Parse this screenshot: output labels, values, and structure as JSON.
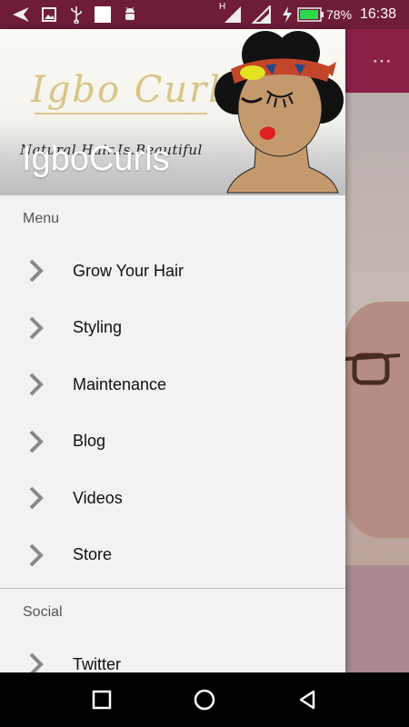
{
  "status_bar": {
    "battery_percent": "78%",
    "time": "16:38",
    "network_label": "H",
    "icons": [
      "back-arrow-icon",
      "image-icon",
      "usb-icon",
      "white-square-icon",
      "android-debug-icon",
      "signal-icon",
      "charging-icon",
      "battery-icon"
    ]
  },
  "drawer": {
    "header": {
      "title": "IgboCurls",
      "logo_text": "Igbo Curls",
      "tagline": "Natural.Hair.Is.Beautiful"
    },
    "sections": [
      {
        "label": "Menu",
        "items": [
          {
            "label": "Grow Your Hair"
          },
          {
            "label": "Styling"
          },
          {
            "label": "Maintenance"
          },
          {
            "label": "Blog"
          },
          {
            "label": "Videos"
          },
          {
            "label": "Store"
          }
        ]
      },
      {
        "label": "Social",
        "items": [
          {
            "label": "Twitter"
          }
        ]
      }
    ]
  },
  "background_app": {
    "overflow_menu": "⋮",
    "accent_color": "#8c2148"
  },
  "nav_bar": {
    "buttons": [
      "recent-apps-icon",
      "home-icon",
      "back-icon"
    ]
  }
}
